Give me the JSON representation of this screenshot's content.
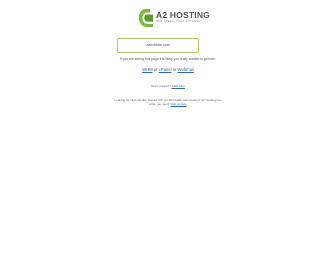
{
  "logo": {
    "brand_a2": "A2",
    "brand_text": "HOSTING",
    "tagline": "OUR SPEED, YOUR SUCCESS"
  },
  "domain": "aabvtdale.com",
  "notice": "If you are seeing this page it is likely you really wanted to go here:",
  "links": [
    {
      "label": "WHM"
    },
    {
      "label": "cPanel"
    },
    {
      "label": "Webmail"
    }
  ],
  "link_separator": "or",
  "support": {
    "prefix": "Need support?",
    "link": "Click here"
  },
  "promo": {
    "line1": "Looking for High Quality, feature rich yet affordable web hosting? A2 Hosting has",
    "line2_prefix": "what you need!",
    "line2_link": "Visit us here"
  },
  "colors": {
    "accent_green": "#7ab940",
    "link_blue": "#2a66b3"
  }
}
